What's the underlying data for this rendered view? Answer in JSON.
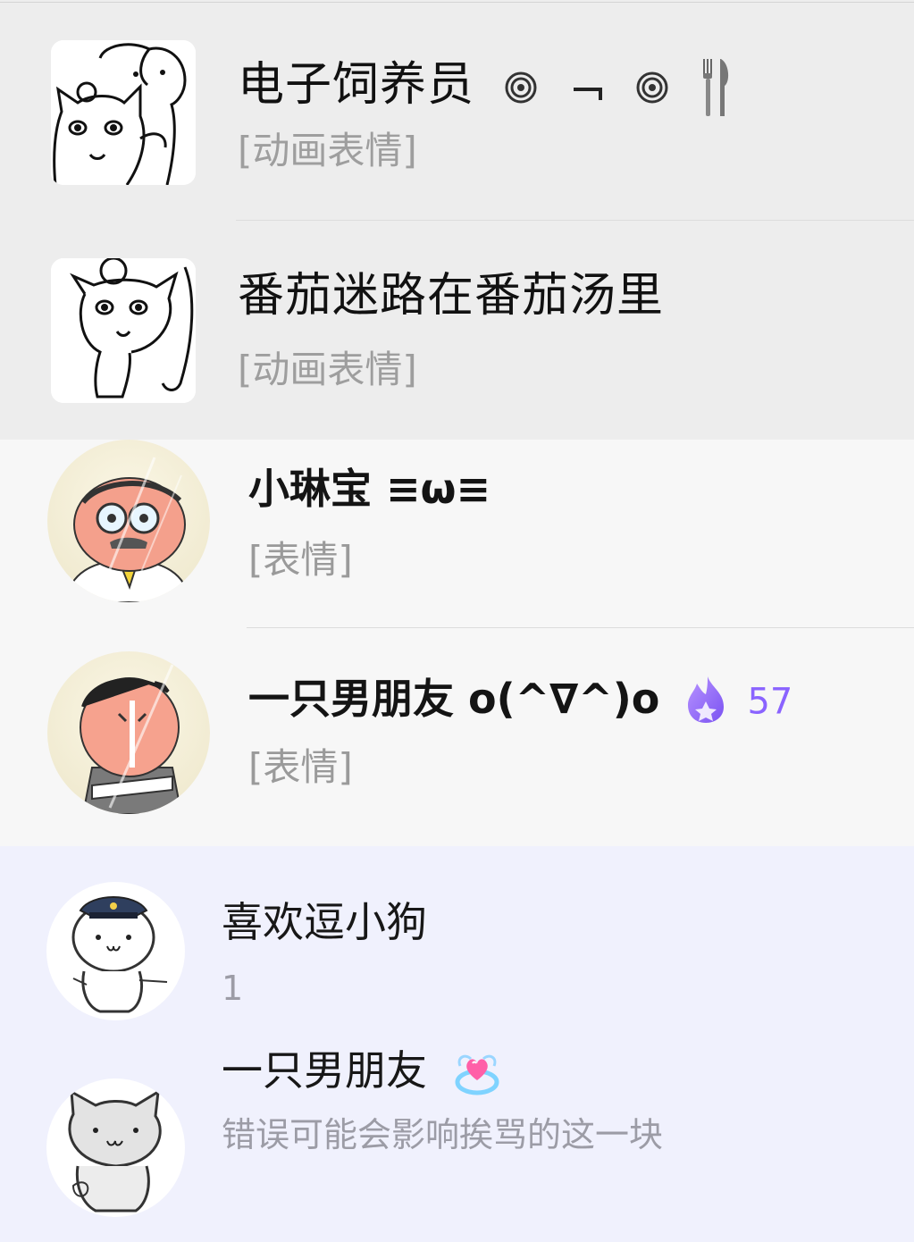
{
  "wechat_chats": [
    {
      "name": "电子饲养员",
      "emoji_icons": [
        "cyclone-icon",
        "corner-bracket-icon",
        "cyclone-icon",
        "fork-and-knife-icon"
      ],
      "preview": "[动画表情]"
    },
    {
      "name": "番茄迷路在番茄汤里",
      "preview": "[动画表情]"
    }
  ],
  "qq_chats": [
    {
      "name": "小琳宝 ≡ω≡",
      "preview": "[表情]"
    },
    {
      "name": "一只男朋友 o(^∇^)o",
      "badge_icon": "purple-flame-icon",
      "badge_value": "57",
      "preview": "[表情]"
    },
    {
      "name": "喜欢逗小狗",
      "preview": "1"
    },
    {
      "name": "一只男朋友",
      "badge_icon": "heart-ring-icon",
      "preview": "错误可能会影响挨骂的这一块"
    }
  ],
  "colors": {
    "wechat_background": "#ededed",
    "qq_background": "#f7f7f7",
    "qq_highlight_background": "#f0f1fd",
    "badge_purple": "#8a63ff",
    "preview_gray": "#9a9a9a"
  }
}
